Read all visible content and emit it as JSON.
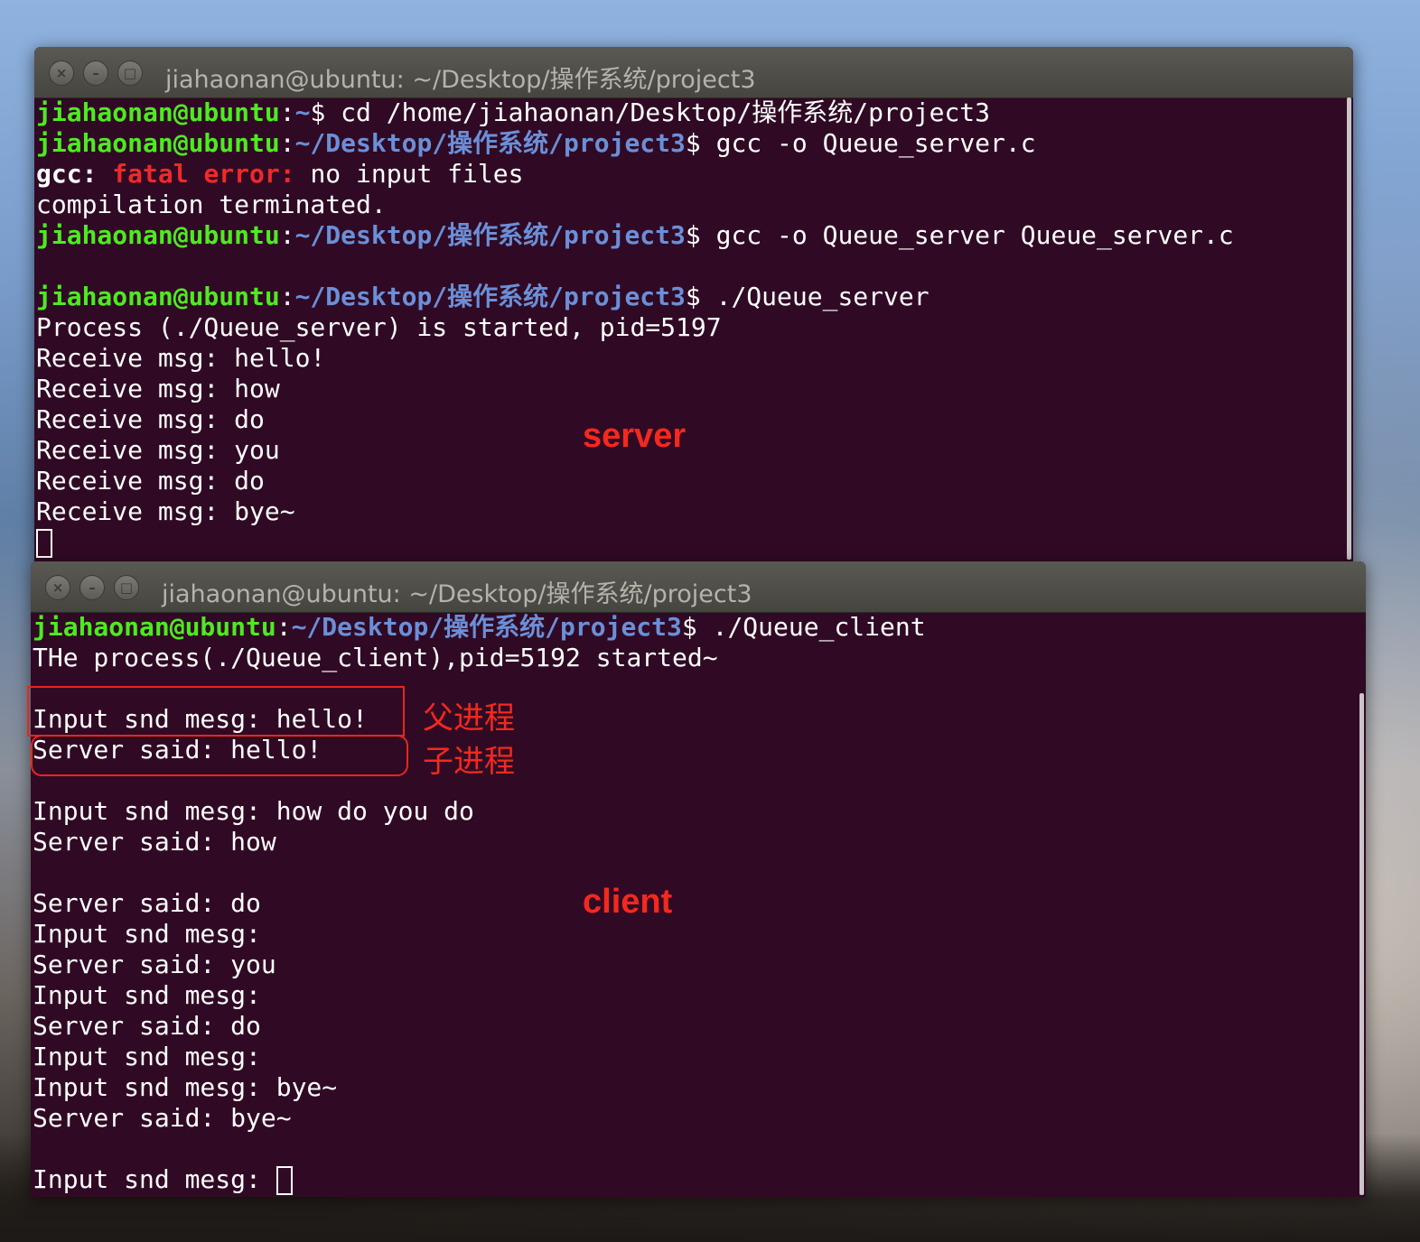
{
  "server_window": {
    "title": "jiahaonan@ubuntu: ~/Desktop/操作系统/project3",
    "buttons": {
      "close": "×",
      "minimize": "–",
      "maximize": "□"
    },
    "lines": [
      {
        "user": "jiahaonan@ubuntu",
        "path": "~",
        "dollar": "$ ",
        "cmd": "cd /home/jiahaonan/Desktop/操作系统/project3"
      },
      {
        "user": "jiahaonan@ubuntu",
        "path": "~/Desktop/操作系统/project3",
        "dollar": "$ ",
        "cmd": "gcc -o Queue_server.c"
      },
      {
        "label": "gcc:",
        "err": "fatal error:",
        "rest": " no input files"
      },
      {
        "text": "compilation terminated."
      },
      {
        "user": "jiahaonan@ubuntu",
        "path": "~/Desktop/操作系统/project3",
        "dollar": "$ ",
        "cmd": "gcc -o Queue_server Queue_server.c"
      },
      {
        "text": ""
      },
      {
        "user": "jiahaonan@ubuntu",
        "path": "~/Desktop/操作系统/project3",
        "dollar": "$ ",
        "cmd": "./Queue_server"
      },
      {
        "text": "Process (./Queue_server) is started, pid=5197"
      },
      {
        "text": "Receive msg: hello!"
      },
      {
        "text": "Receive msg: how"
      },
      {
        "text": "Receive msg: do"
      },
      {
        "text": "Receive msg: you"
      },
      {
        "text": "Receive msg: do"
      },
      {
        "text": "Receive msg: bye~"
      }
    ]
  },
  "client_window": {
    "title": "jiahaonan@ubuntu: ~/Desktop/操作系统/project3",
    "buttons": {
      "close": "×",
      "minimize": "–",
      "maximize": "□"
    },
    "lines": [
      {
        "user": "jiahaonan@ubuntu",
        "path": "~/Desktop/操作系统/project3",
        "dollar": "$ ",
        "cmd": "./Queue_client"
      },
      {
        "text": "THe process(./Queue_client),pid=5192 started~"
      },
      {
        "text": ""
      },
      {
        "text": "Input snd mesg: hello!"
      },
      {
        "text": "Server said: hello!"
      },
      {
        "text": ""
      },
      {
        "text": "Input snd mesg: how do you do"
      },
      {
        "text": "Server said: how"
      },
      {
        "text": ""
      },
      {
        "text": "Server said: do"
      },
      {
        "text": "Input snd mesg:"
      },
      {
        "text": "Server said: you"
      },
      {
        "text": "Input snd mesg:"
      },
      {
        "text": "Server said: do"
      },
      {
        "text": "Input snd mesg:"
      },
      {
        "text": "Input snd mesg: bye~"
      },
      {
        "text": "Server said: bye~"
      },
      {
        "text": ""
      },
      {
        "text": "Input snd mesg: "
      }
    ]
  },
  "annotations": {
    "server_label": "server",
    "client_label": "client",
    "parent_process": "父进程",
    "child_process": "子进程"
  },
  "colors": {
    "terminal_bg": "#300a24",
    "user_green": "#4eea22",
    "path_blue": "#6b8fd8",
    "error_red": "#ef2929",
    "annotation_red": "#f5281e"
  }
}
